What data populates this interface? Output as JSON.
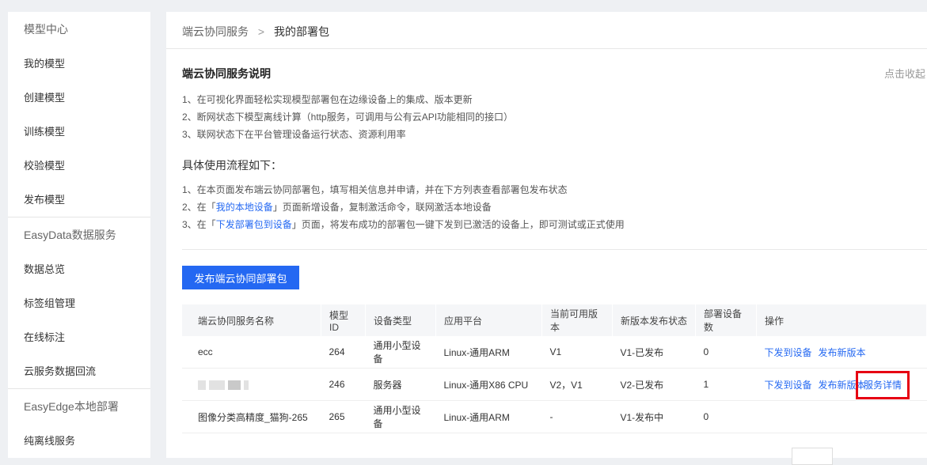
{
  "sidebar": {
    "group1": "模型中心",
    "items1": [
      "我的模型",
      "创建模型",
      "训练模型",
      "校验模型",
      "发布模型"
    ],
    "group2": "EasyData数据服务",
    "items2": [
      "数据总览",
      "标签组管理",
      "在线标注",
      "云服务数据回流"
    ],
    "group3": "EasyEdge本地部署",
    "items3": [
      "纯离线服务"
    ]
  },
  "breadcrumb": {
    "parent": "端云协同服务",
    "separator": ">",
    "current": "我的部署包"
  },
  "intro": {
    "title": "端云协同服务说明",
    "collapse": "点击收起",
    "lines": [
      "1、在可视化界面轻松实现模型部署包在边缘设备上的集成、版本更新",
      "2、断网状态下模型离线计算（http服务，可调用与公有云API功能相同的接口）",
      "3、联网状态下在平台管理设备运行状态、资源利用率"
    ],
    "flow_title": "具体使用流程如下：",
    "flow1": "1、在本页面发布端云协同部署包，填写相关信息并申请，并在下方列表查看部署包发布状态",
    "flow2_pre": "2、在「",
    "flow2_link": "我的本地设备",
    "flow2_post": "」页面新增设备，复制激活命令，联网激活本地设备",
    "flow3_pre": "3、在「",
    "flow3_link": "下发部署包到设备",
    "flow3_post": "」页面，将发布成功的部署包一键下发到已激活的设备上，即可测试或正式使用"
  },
  "publish_button": "发布端云协同部署包",
  "table": {
    "headers": [
      "端云协同服务名称",
      "模型ID",
      "设备类型",
      "应用平台",
      "当前可用版本",
      "新版本发布状态",
      "部署设备数",
      "操作"
    ],
    "rows": [
      {
        "name": "ecc",
        "id": "264",
        "type": "通用小型设备",
        "platform": "Linux-通用ARM",
        "version": "V1",
        "status": "V1-已发布",
        "count": "0",
        "op1": "下发到设备",
        "op2": "发布新版本"
      },
      {
        "name": "",
        "id": "246",
        "type": "服务器",
        "platform": "Linux-通用X86 CPU",
        "version": "V2，V1",
        "status": "V2-已发布",
        "count": "1",
        "op1": "下发到设备",
        "op2": "发布新版本",
        "op3": "服务详情"
      },
      {
        "name": "图像分类高精度_猫狗-265",
        "id": "265",
        "type": "通用小型设备",
        "platform": "Linux-通用ARM",
        "version": "-",
        "status": "V1-发布中",
        "count": "0"
      }
    ]
  }
}
